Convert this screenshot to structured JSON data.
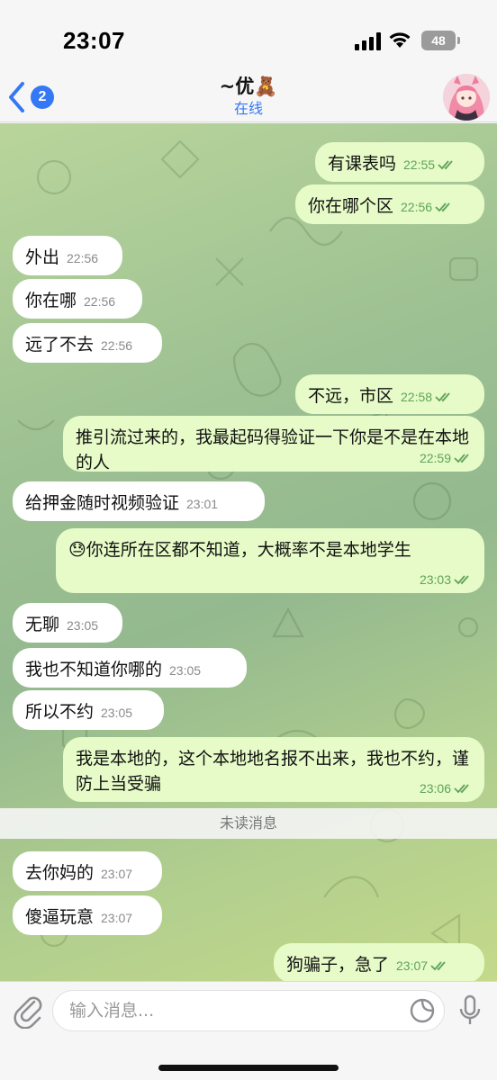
{
  "status": {
    "time": "23:07",
    "battery": "48"
  },
  "header": {
    "back_badge": "2",
    "title": "~优🧸",
    "subtitle": "在线"
  },
  "messages": [
    {
      "dir": "out",
      "text": "有课表吗",
      "time": "22:55"
    },
    {
      "dir": "out",
      "text": "你在哪个区",
      "time": "22:56"
    },
    {
      "dir": "in",
      "text": "外出",
      "time": "22:56"
    },
    {
      "dir": "in",
      "text": "你在哪",
      "time": "22:56"
    },
    {
      "dir": "in",
      "text": "远了不去",
      "time": "22:56"
    },
    {
      "dir": "out",
      "text": "不远，市区",
      "time": "22:58"
    },
    {
      "dir": "out",
      "text": "推引流过来的，我最起码得验证一下你是不是在本地的人",
      "time": "22:59"
    },
    {
      "dir": "in",
      "text": "给押金随时视频验证",
      "time": "23:01"
    },
    {
      "dir": "out",
      "text": "😓你连所在区都不知道，大概率不是本地学生",
      "time": "23:03"
    },
    {
      "dir": "in",
      "text": "无聊",
      "time": "23:05"
    },
    {
      "dir": "in",
      "text": "我也不知道你哪的",
      "time": "23:05"
    },
    {
      "dir": "in",
      "text": "所以不约",
      "time": "23:05"
    },
    {
      "dir": "out",
      "text": "我是本地的，这个本地地名报不出来，我也不约，谨防上当受骗",
      "time": "23:06"
    },
    {
      "dir": "in",
      "text": "去你妈的",
      "time": "23:07"
    },
    {
      "dir": "in",
      "text": "傻逼玩意",
      "time": "23:07"
    },
    {
      "dir": "out",
      "text": "狗骗子，急了",
      "time": "23:07"
    }
  ],
  "unread_divider": "未读消息",
  "input": {
    "placeholder": "输入消息..."
  },
  "icons": {
    "back": "chevron-left-icon",
    "attach": "paperclip-icon",
    "sticker": "sticker-icon",
    "mic": "microphone-icon",
    "signal": "cellular-signal-icon",
    "wifi": "wifi-icon",
    "battery": "battery-icon",
    "read": "double-check-icon"
  },
  "colors": {
    "accent": "#3478f6",
    "outgoing_bubble": "#e6fbc7",
    "incoming_bubble": "#ffffff",
    "check": "#5fa35a"
  }
}
